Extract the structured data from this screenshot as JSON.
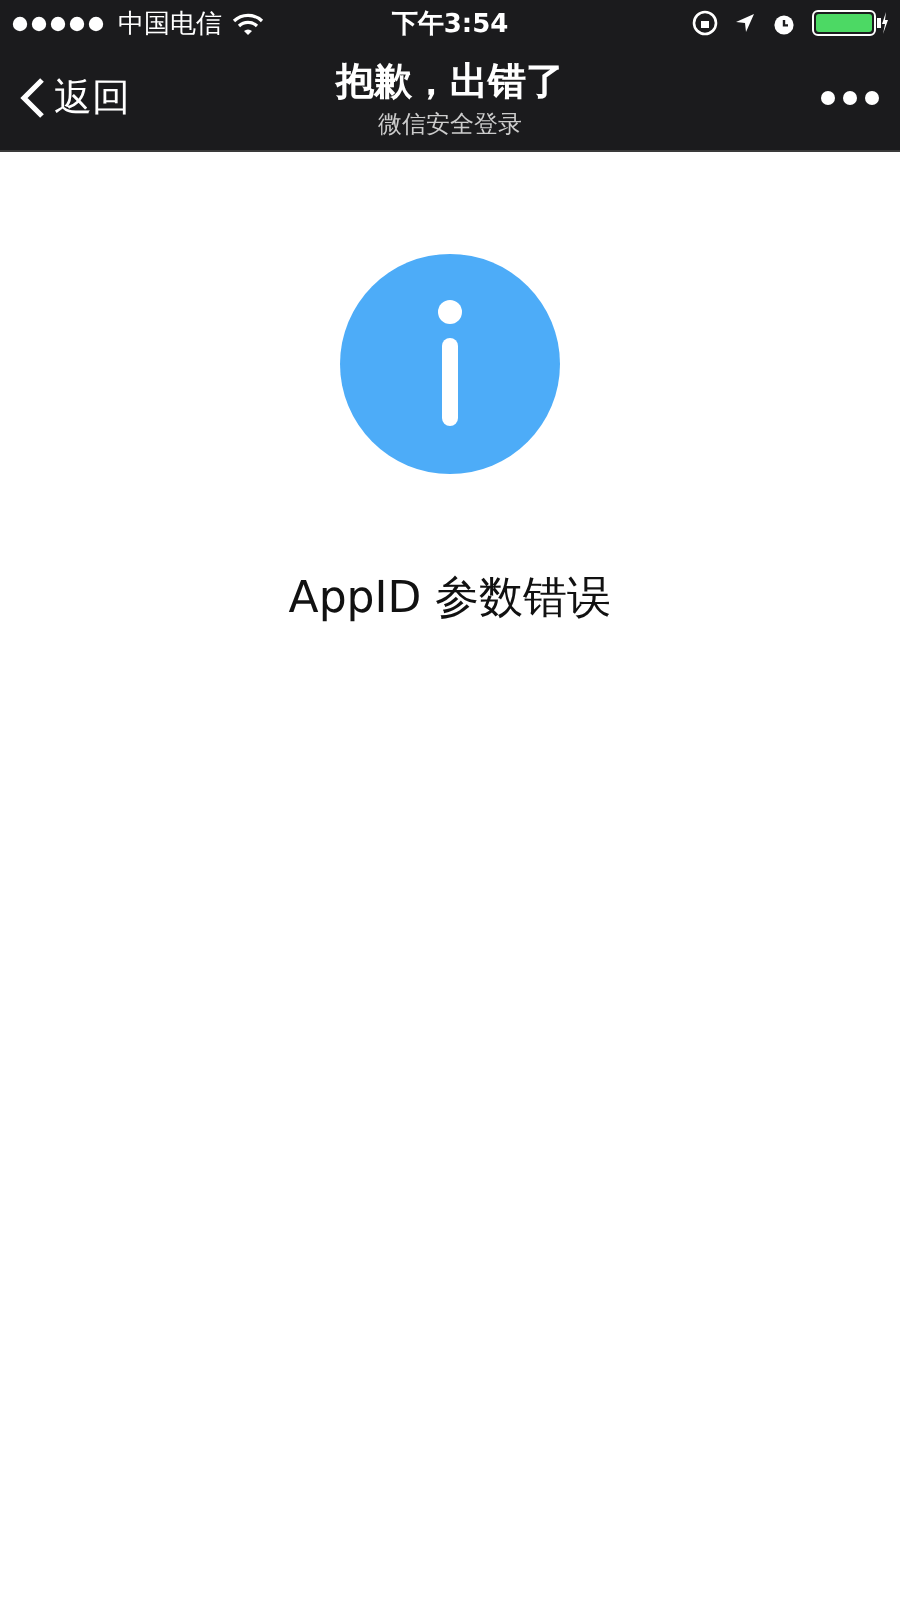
{
  "status_bar": {
    "carrier": "中国电信",
    "time": "下午3:54"
  },
  "nav_bar": {
    "back": "返回",
    "title": "抱歉，出错了",
    "subtitle": "微信安全登录"
  },
  "message": "AppID 参数错误"
}
